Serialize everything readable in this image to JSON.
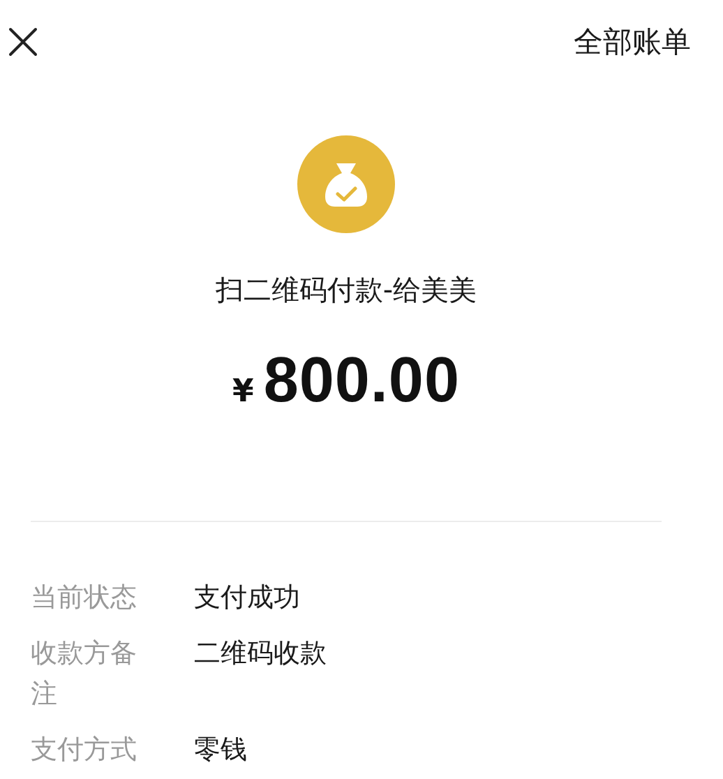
{
  "header": {
    "bills_link": "全部账单"
  },
  "payment": {
    "title": "扫二维码付款-给美美",
    "currency": "¥",
    "amount": "800.00"
  },
  "details": [
    {
      "label": "当前状态",
      "value": "支付成功"
    },
    {
      "label": "收款方备注",
      "value": "二维码收款"
    },
    {
      "label": "支付方式",
      "value": "零钱"
    }
  ]
}
